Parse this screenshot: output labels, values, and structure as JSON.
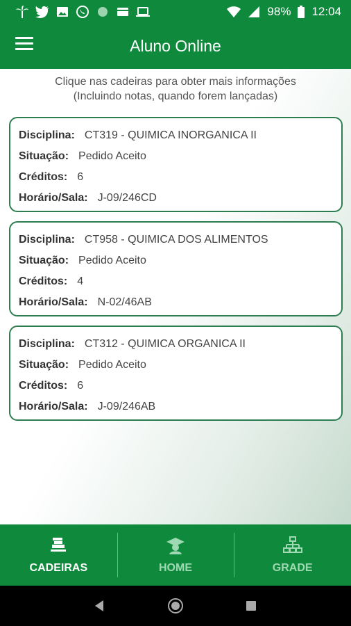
{
  "status_bar": {
    "battery": "98%",
    "time": "12:04"
  },
  "app_bar": {
    "title": "Aluno Online"
  },
  "hint": {
    "line1": "Clique nas cadeiras para obter mais informações",
    "line2": "(Incluindo notas, quando forem lançadas)"
  },
  "labels": {
    "disciplina": "Disciplina:",
    "situacao": "Situação:",
    "creditos": "Créditos:",
    "horario": "Horário/Sala:"
  },
  "courses": [
    {
      "disciplina": "CT319 - QUIMICA INORGANICA II",
      "situacao": "Pedido Aceito",
      "creditos": "6",
      "horario": "J-09/246CD"
    },
    {
      "disciplina": "CT958 - QUIMICA DOS ALIMENTOS",
      "situacao": "Pedido Aceito",
      "creditos": "4",
      "horario": "N-02/46AB"
    },
    {
      "disciplina": "CT312 - QUIMICA ORGANICA II",
      "situacao": "Pedido Aceito",
      "creditos": "6",
      "horario": "J-09/246AB"
    }
  ],
  "bottom_nav": [
    {
      "label": "CADEIRAS",
      "icon": "books-icon",
      "active": true
    },
    {
      "label": "HOME",
      "icon": "graduate-icon",
      "active": false
    },
    {
      "label": "GRADE",
      "icon": "sitemap-icon",
      "active": false
    }
  ],
  "colors": {
    "primary": "#0f8a3c",
    "card_border": "#2e7d51",
    "inactive_nav": "#9fd9b3"
  }
}
